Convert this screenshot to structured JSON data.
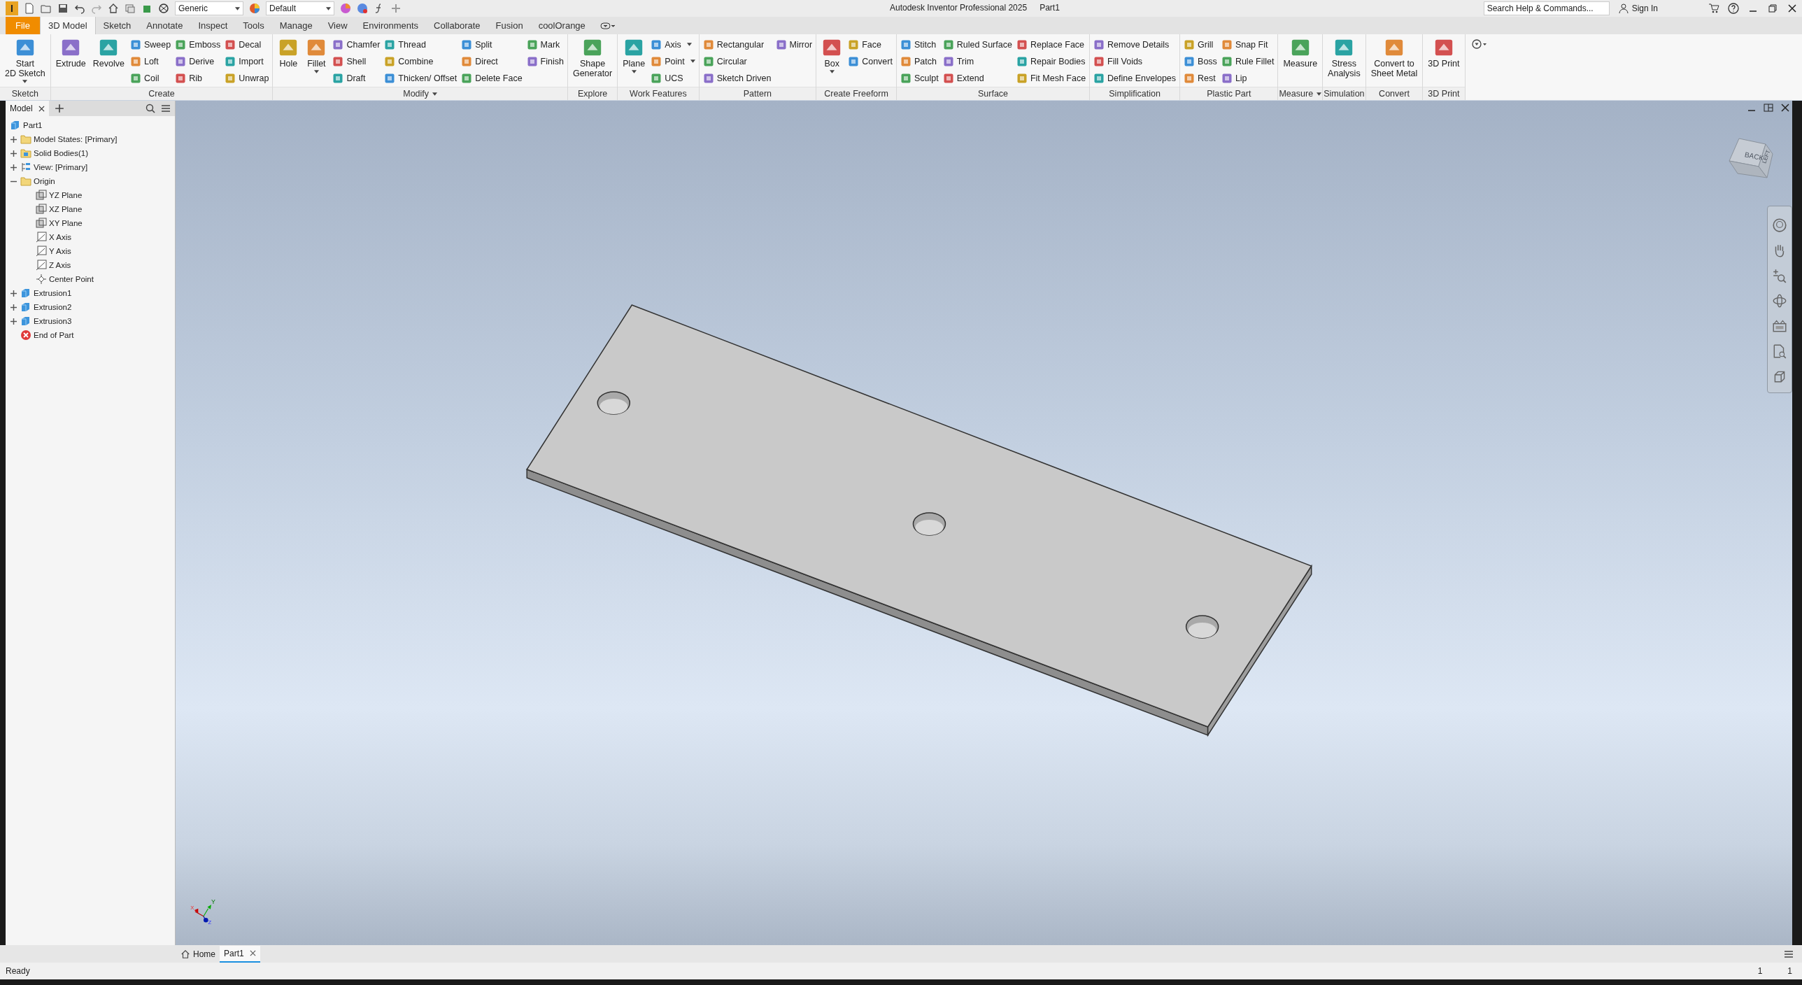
{
  "logo": {
    "letter": "I"
  },
  "quick_access": {
    "material": "Generic",
    "appearance": "Default"
  },
  "window": {
    "title": "Autodesk Inventor Professional 2025",
    "document": "Part1"
  },
  "help": {
    "search_placeholder": "Search Help & Commands...",
    "sign_in": "Sign In"
  },
  "file_tab": {
    "label": "File"
  },
  "tabs": [
    {
      "label": "3D Model",
      "selected": true
    },
    {
      "label": "Sketch",
      "selected": false
    },
    {
      "label": "Annotate",
      "selected": false
    },
    {
      "label": "Inspect",
      "selected": false
    },
    {
      "label": "Tools",
      "selected": false
    },
    {
      "label": "Manage",
      "selected": false
    },
    {
      "label": "View",
      "selected": false
    },
    {
      "label": "Environments",
      "selected": false
    },
    {
      "label": "Collaborate",
      "selected": false
    },
    {
      "label": "Fusion",
      "selected": false
    },
    {
      "label": "coolOrange",
      "selected": false
    }
  ],
  "ribbon": {
    "panels": [
      {
        "title": "Sketch",
        "menu": false,
        "groups": [
          {
            "kind": "large",
            "lines": [
              "Start",
              "2D Sketch"
            ],
            "dropdown": true
          }
        ]
      },
      {
        "title": "Create",
        "menu": false,
        "groups": [
          {
            "kind": "large",
            "lines": [
              "Extrude"
            ],
            "dropdown": false
          },
          {
            "kind": "large",
            "lines": [
              "Revolve"
            ],
            "dropdown": false
          },
          {
            "kind": "column",
            "tools": [
              {
                "label": "Sweep",
                "dropdown": false
              },
              {
                "label": "Loft",
                "dropdown": false
              },
              {
                "label": "Coil",
                "dropdown": false
              }
            ]
          },
          {
            "kind": "column",
            "tools": [
              {
                "label": "Emboss",
                "dropdown": false
              },
              {
                "label": "Derive",
                "dropdown": false
              },
              {
                "label": "Rib",
                "dropdown": false
              }
            ]
          },
          {
            "kind": "column",
            "tools": [
              {
                "label": "Decal",
                "dropdown": false
              },
              {
                "label": "Import",
                "dropdown": false
              },
              {
                "label": "Unwrap",
                "dropdown": false
              }
            ]
          }
        ]
      },
      {
        "title": "Modify",
        "menu": true,
        "groups": [
          {
            "kind": "large",
            "lines": [
              "Hole"
            ],
            "dropdown": false
          },
          {
            "kind": "large",
            "lines": [
              "Fillet"
            ],
            "dropdown": true
          },
          {
            "kind": "column",
            "tools": [
              {
                "label": "Chamfer",
                "dropdown": false
              },
              {
                "label": "Shell",
                "dropdown": false
              },
              {
                "label": "Draft",
                "dropdown": false
              }
            ]
          },
          {
            "kind": "column",
            "tools": [
              {
                "label": "Thread",
                "dropdown": false
              },
              {
                "label": "Combine",
                "dropdown": false
              },
              {
                "label": "Thicken/ Offset",
                "dropdown": false
              }
            ]
          },
          {
            "kind": "column",
            "tools": [
              {
                "label": "Split",
                "dropdown": false
              },
              {
                "label": "Direct",
                "dropdown": false
              },
              {
                "label": "Delete Face",
                "dropdown": false
              }
            ]
          },
          {
            "kind": "column",
            "tools": [
              {
                "label": "Mark",
                "dropdown": false
              },
              {
                "label": "Finish",
                "dropdown": false
              }
            ]
          }
        ]
      },
      {
        "title": "Explore",
        "menu": false,
        "groups": [
          {
            "kind": "large",
            "lines": [
              "Shape",
              "Generator"
            ],
            "dropdown": false
          }
        ]
      },
      {
        "title": "Work Features",
        "menu": false,
        "groups": [
          {
            "kind": "large",
            "lines": [
              "Plane"
            ],
            "dropdown": true
          },
          {
            "kind": "column",
            "tools": [
              {
                "label": "Axis",
                "dropdown": true
              },
              {
                "label": "Point",
                "dropdown": true
              },
              {
                "label": "UCS",
                "dropdown": false
              }
            ]
          }
        ]
      },
      {
        "title": "Pattern",
        "menu": false,
        "groups": [
          {
            "kind": "column",
            "tools": [
              {
                "label": "Rectangular",
                "dropdown": false
              },
              {
                "label": "Circular",
                "dropdown": false
              },
              {
                "label": "Sketch Driven",
                "dropdown": false
              }
            ]
          },
          {
            "kind": "column",
            "tools": [
              {
                "label": "Mirror",
                "dropdown": false
              }
            ]
          }
        ]
      },
      {
        "title": "Create Freeform",
        "menu": false,
        "groups": [
          {
            "kind": "large",
            "lines": [
              "Box"
            ],
            "dropdown": true
          },
          {
            "kind": "column",
            "tools": [
              {
                "label": "Face",
                "dropdown": false
              },
              {
                "label": "Convert",
                "dropdown": false
              }
            ]
          }
        ]
      },
      {
        "title": "Surface",
        "menu": false,
        "groups": [
          {
            "kind": "column",
            "tools": [
              {
                "label": "Stitch",
                "dropdown": false
              },
              {
                "label": "Patch",
                "dropdown": false
              },
              {
                "label": "Sculpt",
                "dropdown": false
              }
            ]
          },
          {
            "kind": "column",
            "tools": [
              {
                "label": "Ruled Surface",
                "dropdown": false
              },
              {
                "label": "Trim",
                "dropdown": false
              },
              {
                "label": "Extend",
                "dropdown": false
              }
            ]
          },
          {
            "kind": "column",
            "tools": [
              {
                "label": "Replace Face",
                "dropdown": false
              },
              {
                "label": "Repair Bodies",
                "dropdown": false
              },
              {
                "label": "Fit Mesh Face",
                "dropdown": false
              }
            ]
          }
        ]
      },
      {
        "title": "Simplification",
        "menu": false,
        "groups": [
          {
            "kind": "column",
            "tools": [
              {
                "label": "Remove Details",
                "dropdown": false
              },
              {
                "label": "Fill Voids",
                "dropdown": false
              },
              {
                "label": "Define Envelopes",
                "dropdown": false
              }
            ]
          }
        ]
      },
      {
        "title": "Plastic Part",
        "menu": false,
        "groups": [
          {
            "kind": "column",
            "tools": [
              {
                "label": "Grill",
                "dropdown": false
              },
              {
                "label": "Boss",
                "dropdown": false
              },
              {
                "label": "Rest",
                "dropdown": false
              }
            ]
          },
          {
            "kind": "column",
            "tools": [
              {
                "label": "Snap Fit",
                "dropdown": false
              },
              {
                "label": "Rule Fillet",
                "dropdown": false
              },
              {
                "label": "Lip",
                "dropdown": false
              }
            ]
          }
        ]
      },
      {
        "title": "Measure",
        "menu": true,
        "groups": [
          {
            "kind": "large",
            "lines": [
              "Measure"
            ],
            "dropdown": false
          }
        ]
      },
      {
        "title": "Simulation",
        "menu": false,
        "groups": [
          {
            "kind": "large",
            "lines": [
              "Stress",
              "Analysis"
            ],
            "dropdown": false
          }
        ]
      },
      {
        "title": "Convert",
        "menu": false,
        "groups": [
          {
            "kind": "large",
            "lines": [
              "Convert to",
              "Sheet Metal"
            ],
            "dropdown": false
          }
        ]
      },
      {
        "title": "3D Print",
        "menu": false,
        "groups": [
          {
            "kind": "large",
            "lines": [
              "3D Print"
            ],
            "dropdown": false
          }
        ]
      }
    ]
  },
  "browser": {
    "tab": "Model",
    "tree": [
      {
        "label": "Part1",
        "kind": "part",
        "children": [
          {
            "label": "Model States: [Primary]",
            "kind": "folder",
            "expanded": false
          },
          {
            "label": "Solid Bodies(1)",
            "kind": "bodies",
            "expanded": false
          },
          {
            "label": "View: [Primary]",
            "kind": "view",
            "expanded": false
          },
          {
            "label": "Origin",
            "kind": "folder",
            "expanded": true,
            "children": [
              {
                "label": "YZ Plane",
                "kind": "plane"
              },
              {
                "label": "XZ Plane",
                "kind": "plane"
              },
              {
                "label": "XY Plane",
                "kind": "plane"
              },
              {
                "label": "X Axis",
                "kind": "axis"
              },
              {
                "label": "Y Axis",
                "kind": "axis"
              },
              {
                "label": "Z Axis",
                "kind": "axis"
              },
              {
                "label": "Center Point",
                "kind": "point"
              }
            ]
          },
          {
            "label": "Extrusion1",
            "kind": "extrusion",
            "expanded": false
          },
          {
            "label": "Extrusion2",
            "kind": "extrusion",
            "expanded": false
          },
          {
            "label": "Extrusion3",
            "kind": "extrusion",
            "expanded": false
          },
          {
            "label": "End of Part",
            "kind": "end"
          }
        ]
      }
    ]
  },
  "view_cube": {
    "faces": [
      "BACK",
      "LEFT"
    ]
  },
  "triad": {
    "labels": [
      "X",
      "Y",
      "Z"
    ]
  },
  "document_tabs": [
    {
      "label": "Home",
      "kind": "home",
      "selected": false
    },
    {
      "label": "Part1",
      "kind": "document",
      "selected": true
    }
  ],
  "status_bar": {
    "message": "Ready",
    "readouts": [
      "1",
      "1"
    ]
  }
}
